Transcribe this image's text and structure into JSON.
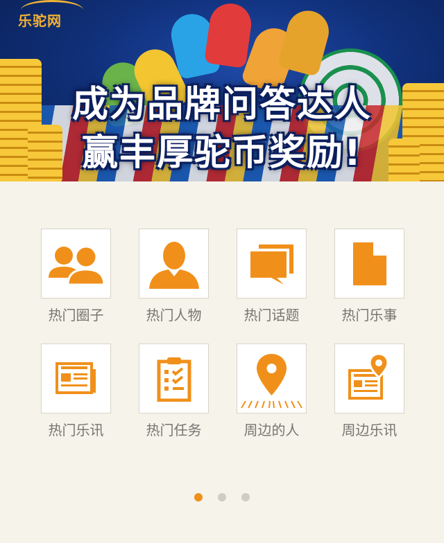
{
  "banner": {
    "logo_text": "乐驼网",
    "line1": "成为品牌问答达人",
    "line2": "赢丰厚驼币奖励!"
  },
  "colors": {
    "accent": "#f0901a",
    "background": "#f5f3ea",
    "dot_inactive": "#cfccc2"
  },
  "menu": [
    {
      "label": "热门圈子",
      "icon": "group-icon"
    },
    {
      "label": "热门人物",
      "icon": "person-icon"
    },
    {
      "label": "热门话题",
      "icon": "chat-bubbles-icon"
    },
    {
      "label": "热门乐事",
      "icon": "document-icon"
    },
    {
      "label": "热门乐讯",
      "icon": "newspaper-icon"
    },
    {
      "label": "热门任务",
      "icon": "clipboard-checklist-icon"
    },
    {
      "label": "周边的人",
      "icon": "location-pin-icon"
    },
    {
      "label": "周边乐讯",
      "icon": "nearby-news-icon"
    }
  ],
  "pager": {
    "count": 3,
    "active_index": 0
  }
}
